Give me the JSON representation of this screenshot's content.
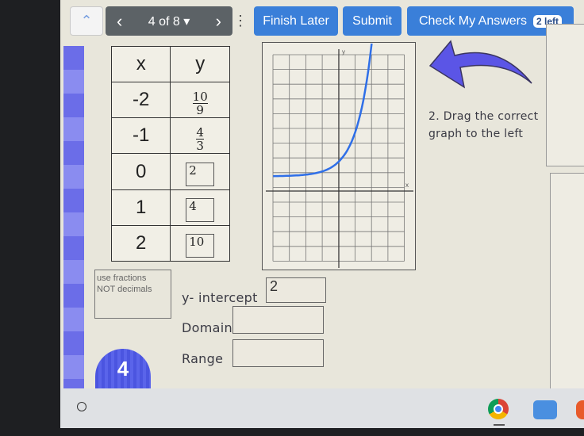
{
  "toolbar": {
    "up_icon": "double-chevron-up-icon",
    "prev": "‹",
    "page": "4 of 8 ▾",
    "next": "›",
    "more": "⋮",
    "finish_later": "Finish Later",
    "submit": "Submit",
    "check_answers": "Check My Answers",
    "badge": "2 left"
  },
  "table": {
    "headers": [
      "x",
      "y"
    ],
    "rows": [
      {
        "x": "-2",
        "num": "10",
        "den": "9"
      },
      {
        "x": "-1",
        "num": "4",
        "den": "3"
      },
      {
        "x": "0",
        "y": "2"
      },
      {
        "x": "1",
        "y": "4"
      },
      {
        "x": "2",
        "y": "10"
      }
    ]
  },
  "graph": {
    "axis_x": "x",
    "axis_y": "y",
    "curve_color": "#2f6fe8"
  },
  "instructions": {
    "line1": "2. Drag the correct",
    "line2": "graph  to the left"
  },
  "note": {
    "line1": "use fractions",
    "line2": "NOT decimals"
  },
  "fields": {
    "y_intercept_label": "y- intercept",
    "y_intercept_value": "2",
    "domain_label": "Domain",
    "domain_value": "",
    "range_label": "Range",
    "range_value": ""
  },
  "bubble": "4",
  "colors": {
    "accent": "#3a7fd9",
    "arrow": "#5b55e6"
  }
}
